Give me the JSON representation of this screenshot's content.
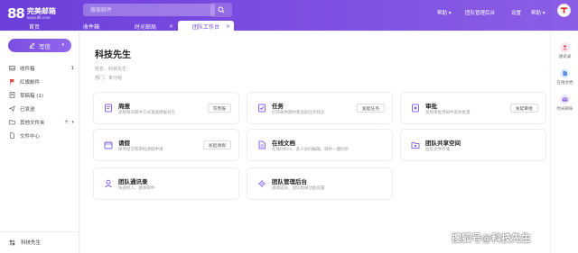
{
  "app": {
    "logo_mark": "88",
    "logo_name": "完美邮箱",
    "logo_url": "www.88.com"
  },
  "search": {
    "placeholder": "搜索邮件"
  },
  "topnav": {
    "help": "帮助",
    "team_admin": "团队管理后台",
    "settings": "设置",
    "more": "帮助"
  },
  "tabs": [
    {
      "label": "首页"
    },
    {
      "label": "收件箱"
    },
    {
      "label": "时光邮局"
    },
    {
      "label": "团队工作台"
    }
  ],
  "sidebar": {
    "compose_label": "写信",
    "items": [
      {
        "label": "收件箱",
        "count": "1",
        "icon": "inbox-icon"
      },
      {
        "label": "红旗邮件",
        "icon": "flag-icon"
      },
      {
        "label": "草稿箱 (1)",
        "icon": "draft-icon"
      },
      {
        "label": "已发送",
        "icon": "sent-icon"
      },
      {
        "label": "其他文件夹",
        "icon": "folder-icon"
      },
      {
        "label": "文件中心",
        "icon": "file-icon"
      }
    ],
    "user_name": "科技先生"
  },
  "main": {
    "title": "科技先生",
    "name_label": "姓名：",
    "name_value": "科技先生",
    "dept_label": "部门：",
    "dept_value": "未分组",
    "cards": [
      {
        "name": "周报",
        "desc": "高频每日邮件方式发送周报对方",
        "button": "写周报",
        "icon": "weekly-report-icon",
        "color": "#8a67e8"
      },
      {
        "name": "任务",
        "desc": "打开邮件随时和追踪任务状态",
        "button": "发起任务",
        "icon": "task-icon",
        "color": "#8a67e8"
      },
      {
        "name": "审批",
        "desc": "高频审批用邮件高效批量",
        "button": "发起审批",
        "icon": "approval-icon",
        "color": "#8a67e8"
      },
      {
        "name": "请假",
        "desc": "邮件提交和审批请假申请",
        "button": "发起请假",
        "icon": "leave-icon",
        "color": "#8a67e8"
      },
      {
        "name": "在线文档",
        "desc": "在线Office、多人协同编辑，邮件一键同步",
        "button": "",
        "icon": "online-doc-icon",
        "color": "#8a67e8"
      },
      {
        "name": "团队共享空间",
        "desc": "团队文件存储",
        "button": "",
        "icon": "shared-space-icon",
        "color": "#8a67e8"
      },
      {
        "name": "团队通讯录",
        "desc": "快速找人、群发邮件",
        "button": "",
        "icon": "contacts-icon",
        "color": "#8a67e8"
      },
      {
        "name": "团队管理后台",
        "desc": "邀请成员、团队相关功能设置",
        "button": "",
        "icon": "team-admin-icon",
        "color": "#8a67e8"
      }
    ]
  },
  "rail": [
    {
      "label": "通讯录",
      "icon": "contacts-icon",
      "color": "#e05b7a"
    },
    {
      "label": "在线文档",
      "icon": "doc-icon",
      "color": "#5b8de0"
    },
    {
      "label": "时光邮局",
      "icon": "time-mail-icon",
      "color": "#8a67e8"
    }
  ],
  "watermark": "搜狐号@科技先生"
}
